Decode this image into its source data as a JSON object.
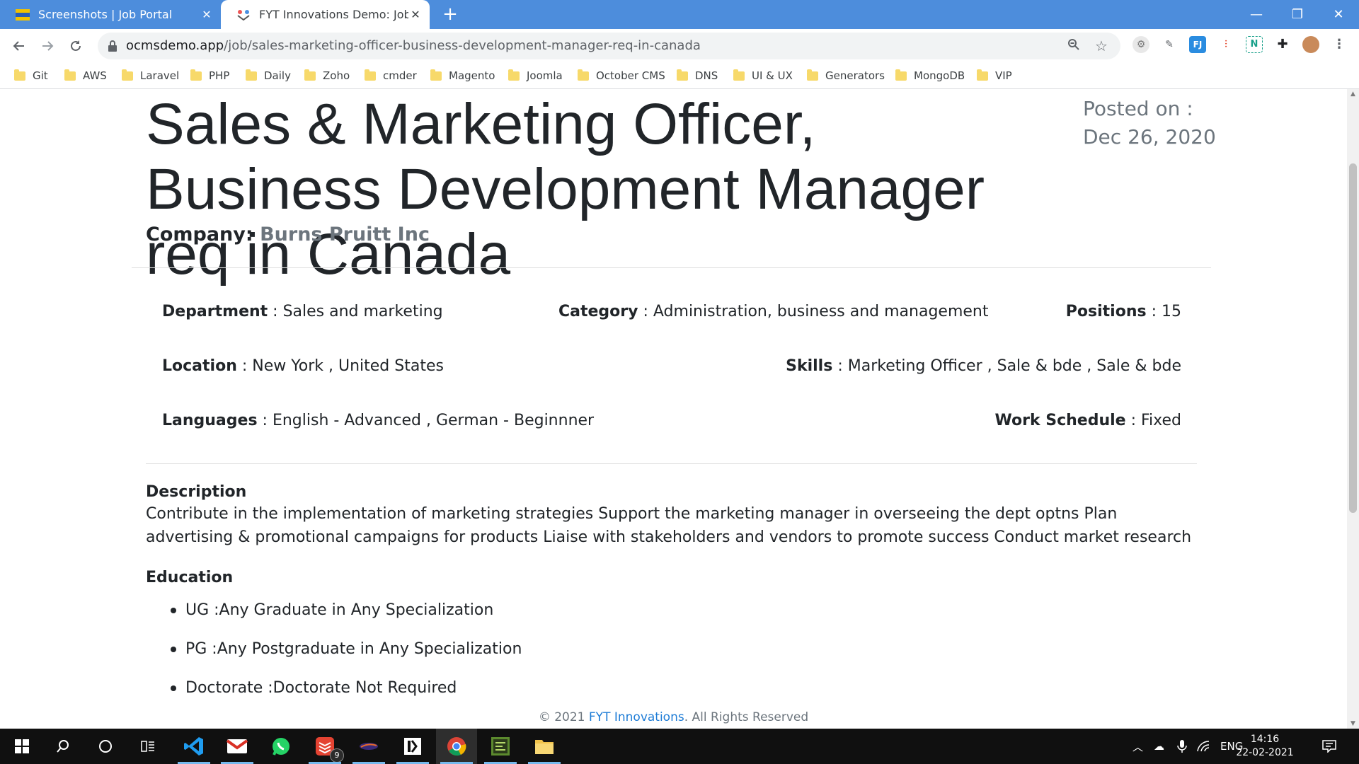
{
  "browser": {
    "tabs": [
      {
        "label": "Screenshots | Job Portal",
        "active": false
      },
      {
        "label": "FYT Innovations Demo: Job detai",
        "active": true
      }
    ],
    "new_tab": "+",
    "window_controls": {
      "minimize": "—",
      "restore": "❐",
      "close": "✕"
    },
    "address": {
      "domain": "ocmsdemo.app",
      "path": "/job/sales-marketing-officer-business-development-manager-req-in-canada"
    },
    "bookmarks": [
      "Git",
      "AWS",
      "Laravel",
      "PHP",
      "Daily",
      "Zoho",
      "cmder",
      "Magento",
      "Joomla",
      "October CMS",
      "DNS",
      "UI & UX",
      "Generators",
      "MongoDB",
      "VIP"
    ],
    "extension_icons": [
      "settings-gear-extension-icon",
      "eyedropper-extension-icon",
      "fj-extension-icon",
      "red-extension-icon",
      "n-extension-icon",
      "puzzle-icon",
      "profile-avatar"
    ]
  },
  "job": {
    "title": "Sales & Marketing Officer, Business Development Manager req in Canada",
    "posted_label": "Posted on :",
    "posted_date": "Dec 26, 2020",
    "company_label": "Company:",
    "company_name": "Burns Pruitt Inc",
    "details": {
      "department_label": "Department",
      "department": " : Sales and marketing",
      "category_label": "Category",
      "category": " : Administration, business and management",
      "positions_label": "Positions",
      "positions": " : 15",
      "location_label": "Location",
      "location": " : New York , United States",
      "skills_label": "Skills",
      "skills": " : Marketing Officer , Sale & bde , Sale & bde",
      "languages_label": "Languages",
      "languages": " : English - Advanced , German - Beginnner",
      "schedule_label": "Work Schedule",
      "schedule": " : Fixed"
    },
    "description_heading": "Description",
    "description": "Contribute in the implementation of marketing strategies Support the marketing manager in overseeing the dept optns Plan advertising & promotional campaigns for products Liaise with stakeholders and vendors to promote success Conduct market research",
    "education_heading": "Education",
    "education": [
      "UG :Any Graduate in Any Specialization",
      "PG :Any Postgraduate in Any Specialization",
      "Doctorate :Doctorate Not Required"
    ]
  },
  "footer": {
    "prefix": "© 2021 ",
    "brand": "FYT Innovations",
    "suffix": ". All Rights Reserved"
  },
  "taskbar": {
    "apps": [
      "vscode-icon",
      "gmail-icon",
      "whatsapp-icon",
      "todoist-icon",
      "terminal-icon",
      "app-icon",
      "chrome-icon",
      "sublime-icon",
      "file-explorer-icon"
    ],
    "todoist_badge": "9",
    "language": "ENG",
    "time": "14:16",
    "date": "22-02-2021"
  },
  "colors": {
    "titlebar": "#4d8ddc",
    "link": "#1e7cd6",
    "muted": "#6c757d"
  }
}
